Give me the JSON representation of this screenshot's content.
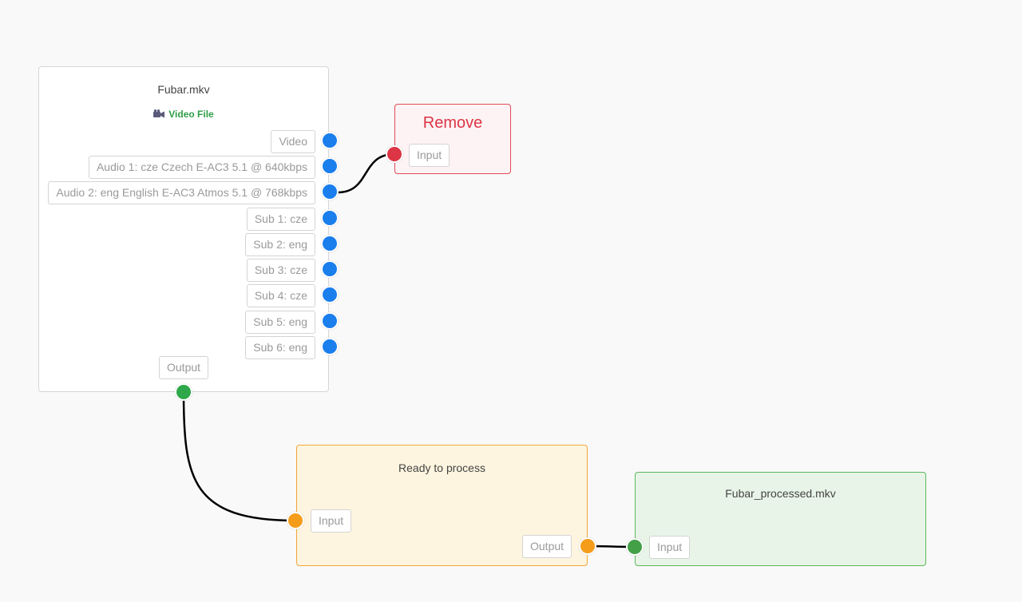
{
  "nodes": {
    "source": {
      "title": "Fubar.mkv",
      "type_label": "Video File",
      "type_icon": "video-camera-icon",
      "streams": [
        {
          "label": "Video"
        },
        {
          "label": "Audio 1: cze Czech E-AC3 5.1 @ 640kbps"
        },
        {
          "label": "Audio 2: eng English E-AC3 Atmos 5.1 @ 768kbps"
        },
        {
          "label": "Sub 1: cze"
        },
        {
          "label": "Sub 2: eng"
        },
        {
          "label": "Sub 3: cze"
        },
        {
          "label": "Sub 4: cze"
        },
        {
          "label": "Sub 5: eng"
        },
        {
          "label": "Sub 6: eng"
        }
      ],
      "output_label": "Output"
    },
    "remove": {
      "title": "Remove",
      "input_label": "Input"
    },
    "process": {
      "title": "Ready to process",
      "input_label": "Input",
      "output_label": "Output"
    },
    "output": {
      "title": "Fubar_processed.mkv",
      "input_label": "Input"
    }
  },
  "colors": {
    "stream_port": "#1a7eed",
    "remove": "#dc3545",
    "source_output_port": "#2ea84a",
    "process_port": "#f59c1a",
    "output_port": "#43a047"
  }
}
